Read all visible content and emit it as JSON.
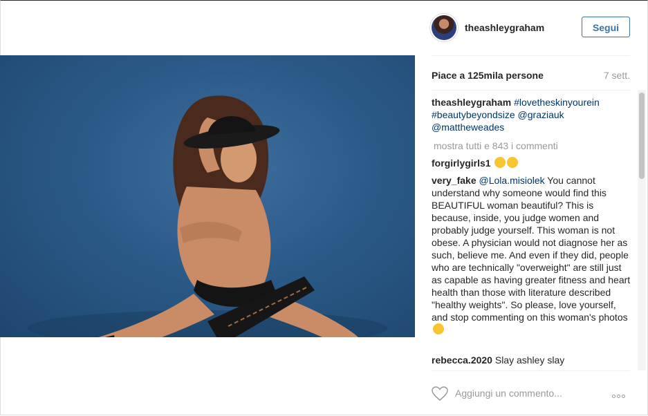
{
  "post": {
    "username": "theashleygraham",
    "follow_label": "Segui",
    "likes_text": "Piace a 125mila persone",
    "time_ago": "7 sett."
  },
  "caption": {
    "username": "theashleygraham",
    "tags": [
      "#lovetheskinyourein",
      "#beautybeyondsize",
      "@graziauk",
      "@mattheweades"
    ]
  },
  "load_more": "mostra tutti e 843 i commenti",
  "comments": [
    {
      "username": "forgirlygirls1",
      "text": "",
      "emojis": [
        "smiling-face-icon",
        "kissing-face-icon"
      ]
    },
    {
      "username": "very_fake",
      "mention": "@Lola.misiolek",
      "text": "You cannot understand why someone would find this BEAUTIFUL woman beautiful? This is because, inside, you judge women and probably judge yourself. This woman is not obese. A physician would not diagnose her as such, believe me. And even if they did, people who are technically \"overweight\" are still just as capable as having greater fitness and heart health than those with literature described \"healthy weights\". So please, love yourself, and stop commenting on this woman's photos",
      "emojis": [
        "tears-of-joy-icon"
      ]
    },
    {
      "username": "rebecca.2020",
      "text": "Slay ashley slay"
    }
  ],
  "add_comment": {
    "placeholder": "Aggiungi un commento..."
  },
  "colors": {
    "link": "#003569",
    "follow": "#3f729b",
    "muted": "#999999",
    "photo_bg": "#2b5a88"
  }
}
